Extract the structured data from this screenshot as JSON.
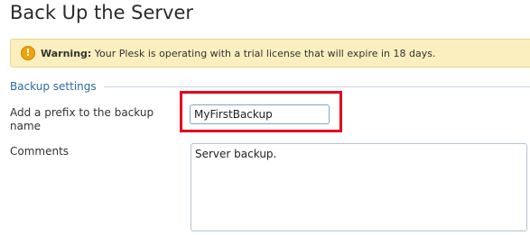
{
  "page": {
    "title": "Back Up the Server"
  },
  "warning": {
    "icon": "warning-icon",
    "icon_glyph": "!",
    "label": "Warning:",
    "message": " Your Plesk is operating with a trial license that will expire in 18 days."
  },
  "backup_settings": {
    "section_title": "Backup settings",
    "prefix": {
      "label": "Add a prefix to the backup name",
      "value": "MyFirstBackup"
    },
    "comments": {
      "label": "Comments",
      "value": "Server backup."
    }
  },
  "colors": {
    "highlight": "#e3001b",
    "warning_bg": "#fbefbf",
    "section_title": "#2a6aa0"
  }
}
